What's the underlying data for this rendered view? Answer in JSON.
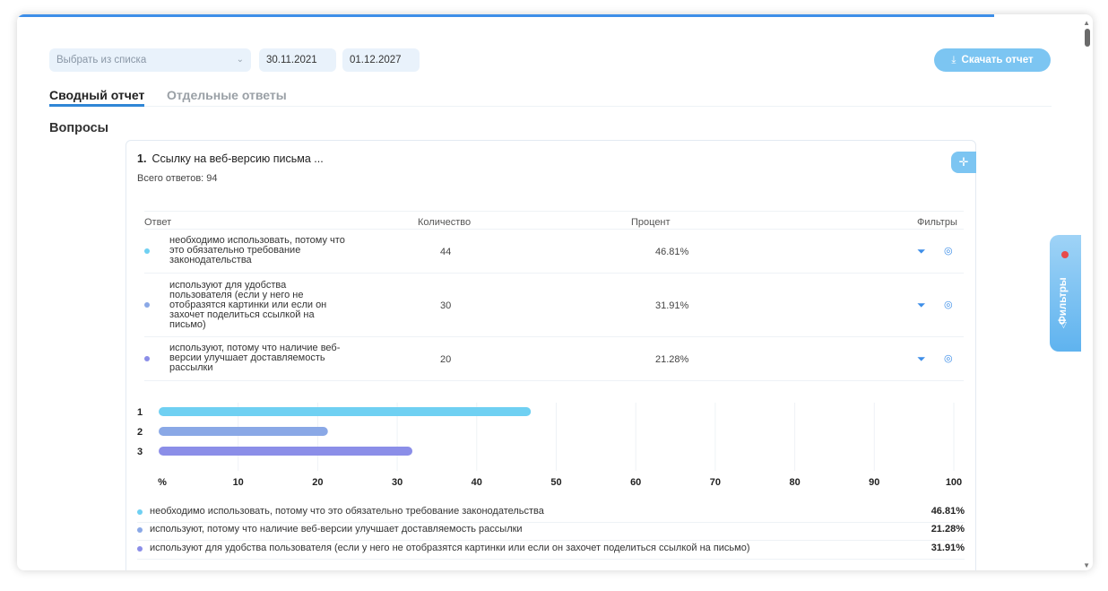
{
  "toolbar": {
    "select_placeholder": "Выбрать из списка",
    "date_from": "30.11.2021",
    "date_to": "01.12.2027",
    "download_label": "Скачать отчет"
  },
  "tabs": [
    {
      "label": "Сводный отчет",
      "active": true
    },
    {
      "label": "Отдельные ответы",
      "active": false
    }
  ],
  "section_title": "Вопросы",
  "question": {
    "number": "1.",
    "title": "Ссылку на веб-версию письма ...",
    "total": "Всего ответов: 94",
    "add_icon": "plus-sparkle-icon"
  },
  "table": {
    "headers": {
      "answer": "Ответ",
      "count": "Количество",
      "percent": "Процент",
      "filters": "Фильтры"
    },
    "rows": [
      {
        "answer": "необходимо использовать, потому что это обязательно требование законодательства",
        "count": "44",
        "percent": "46.81%",
        "color": "#6fd0f2"
      },
      {
        "answer": "используют для удобства пользователя (если у него не отобразятся картинки или если он захочет поделиться ссылкой на письмо)",
        "count": "30",
        "percent": "31.91%",
        "color": "#8aa8e6"
      },
      {
        "answer": "используют, потому что наличие веб-версии улучшает доставляемость рассылки",
        "count": "20",
        "percent": "21.28%",
        "color": "#8b8ee8"
      }
    ]
  },
  "chart_data": {
    "type": "bar",
    "orientation": "horizontal",
    "categories": [
      "1",
      "2",
      "3"
    ],
    "values": [
      46.81,
      21.28,
      31.91
    ],
    "colors": [
      "#6fd0f2",
      "#8aa8e6",
      "#8b8ee8"
    ],
    "x_ticks": [
      "%",
      "10",
      "20",
      "30",
      "40",
      "50",
      "60",
      "70",
      "80",
      "90",
      "100"
    ],
    "xlim": [
      0,
      100
    ],
    "grid": true
  },
  "legend": [
    {
      "text": "необходимо использовать, потому что это обязательно требование законодательства",
      "value": "46.81%",
      "color": "#6fd0f2"
    },
    {
      "text": "используют, потому что наличие веб-версии улучшает доставляемость рассылки",
      "value": "21.28%",
      "color": "#8aa8e6"
    },
    {
      "text": "используют для удобства пользователя (если у него не отобразятся картинки или если он захочет поделиться ссылкой на письмо)",
      "value": "31.91%",
      "color": "#8b8ee8"
    }
  ],
  "side_panel": {
    "label": "Фильтры"
  },
  "colors": {
    "accent": "#3d8ee8",
    "button": "#7cc5f2"
  }
}
